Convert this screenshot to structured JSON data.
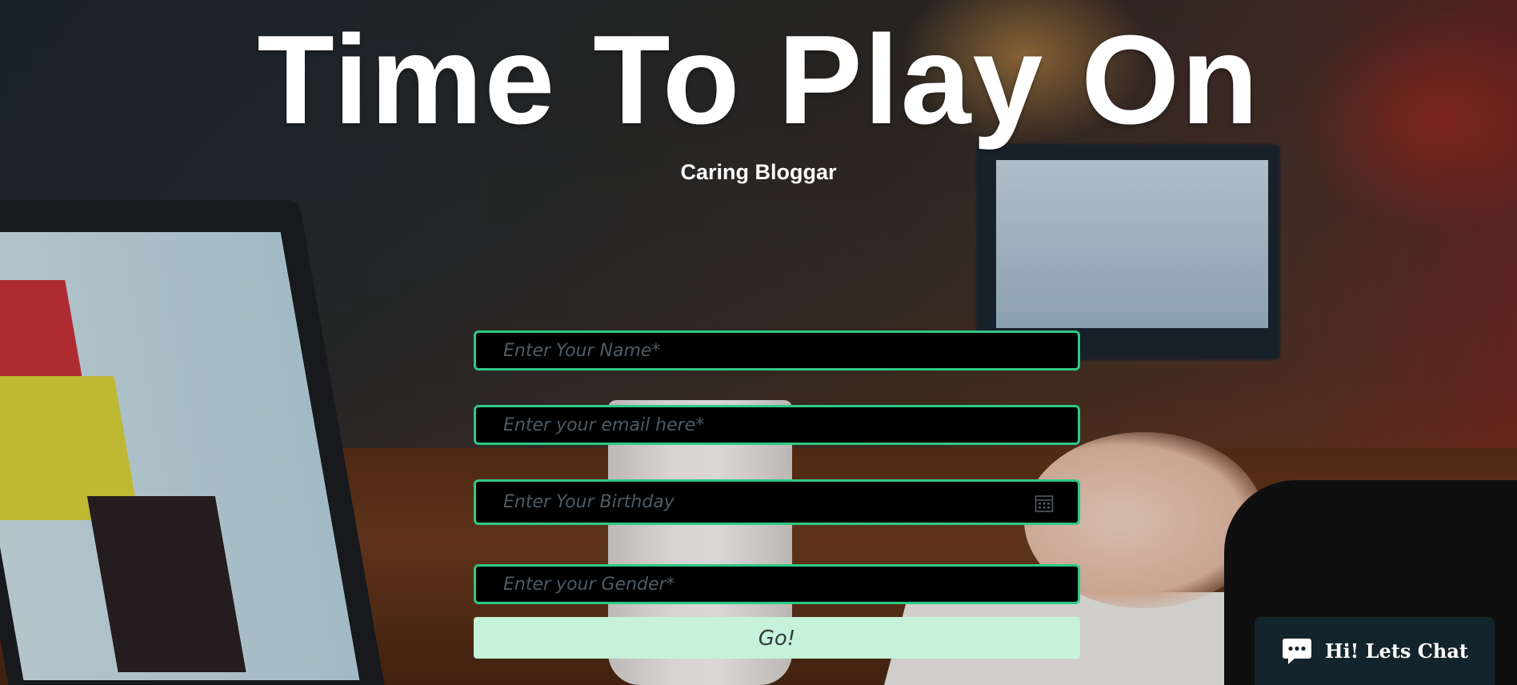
{
  "hero": {
    "title": "Time To Play On",
    "subtitle": "Caring Bloggar"
  },
  "form": {
    "name_placeholder": "Enter Your Name*",
    "email_placeholder": "Enter your email here*",
    "birthday_placeholder": "Enter Your Birthday",
    "gender_placeholder": "Enter your Gender*",
    "submit_label": "Go!"
  },
  "chat": {
    "label": "Hi! Lets Chat"
  },
  "colors": {
    "field_border": "#2fc985",
    "submit_bg": "#c5f2d9",
    "chat_bg": "#14242c"
  },
  "icons": {
    "birthday": "calendar-icon",
    "chat": "chat-bubble-icon"
  }
}
